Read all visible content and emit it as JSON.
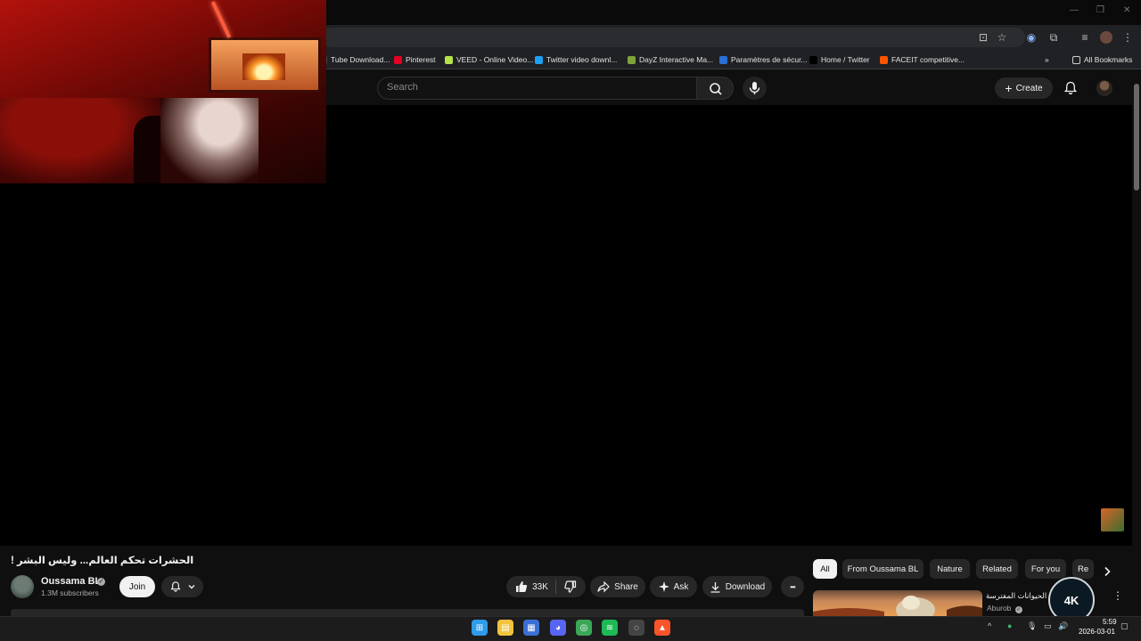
{
  "browser": {
    "window_controls": {
      "minimize": "—",
      "restore": "❐",
      "close": "✕"
    },
    "bookmarks": [
      {
        "label": "Tube Download...",
        "icon": "youtube-downloader-icon",
        "color": "#444444"
      },
      {
        "label": "Pinterest",
        "icon": "pinterest-icon",
        "color": "#e60023"
      },
      {
        "label": "VEED - Online Video...",
        "icon": "veed-icon",
        "color": "#b6e34a"
      },
      {
        "label": "Twitter video downl...",
        "icon": "twitter-downloader-icon",
        "color": "#1da1f2"
      },
      {
        "label": "DayZ Interactive Ma...",
        "icon": "dayz-icon",
        "color": "#7ea33a"
      },
      {
        "label": "Paramètres de sécur...",
        "icon": "security-settings-icon",
        "color": "#2a6fd6"
      },
      {
        "label": "Home / Twitter",
        "icon": "x-icon",
        "color": "#000000"
      },
      {
        "label": "FACEIT competitive...",
        "icon": "faceit-icon",
        "color": "#ff5500"
      }
    ],
    "all_bookmarks_label": "All Bookmarks",
    "more_bookmarks": "»"
  },
  "youtube": {
    "search_placeholder": "Search",
    "create_label": "Create"
  },
  "video": {
    "title": "الحشرات تحكم العالم... وليس البشر !",
    "channel_name": "Oussama BL",
    "subscribers": "1.3M subscribers",
    "join_label": "Join",
    "like_count": "33K",
    "share_label": "Share",
    "ask_label": "Ask",
    "download_label": "Download",
    "more_label": "•••"
  },
  "chips": [
    "All",
    "From Oussama BL",
    "Nature",
    "Related",
    "For you",
    "Re"
  ],
  "active_chip": "All",
  "recommendation": {
    "title": "أكل الحيوانات المفترسة",
    "channel": "Aburob",
    "more": "⋮"
  },
  "overlay_logo": {
    "text": "4K"
  },
  "taskbar": {
    "apps": [
      {
        "name": "windows-start-icon",
        "color": "#2f9bea"
      },
      {
        "name": "file-explorer-icon",
        "color": "#f2c33d"
      },
      {
        "name": "microsoft-store-icon",
        "color": "#3b6fd6"
      },
      {
        "name": "discord-icon",
        "color": "#5865f2"
      },
      {
        "name": "chrome-icon",
        "color": "#3aa757"
      },
      {
        "name": "spotify-icon",
        "color": "#1db954"
      },
      {
        "name": "obs-icon",
        "color": "#444444"
      },
      {
        "name": "brave-icon",
        "color": "#fb542b"
      }
    ],
    "time": "5:59",
    "date": "2026-03-01"
  }
}
